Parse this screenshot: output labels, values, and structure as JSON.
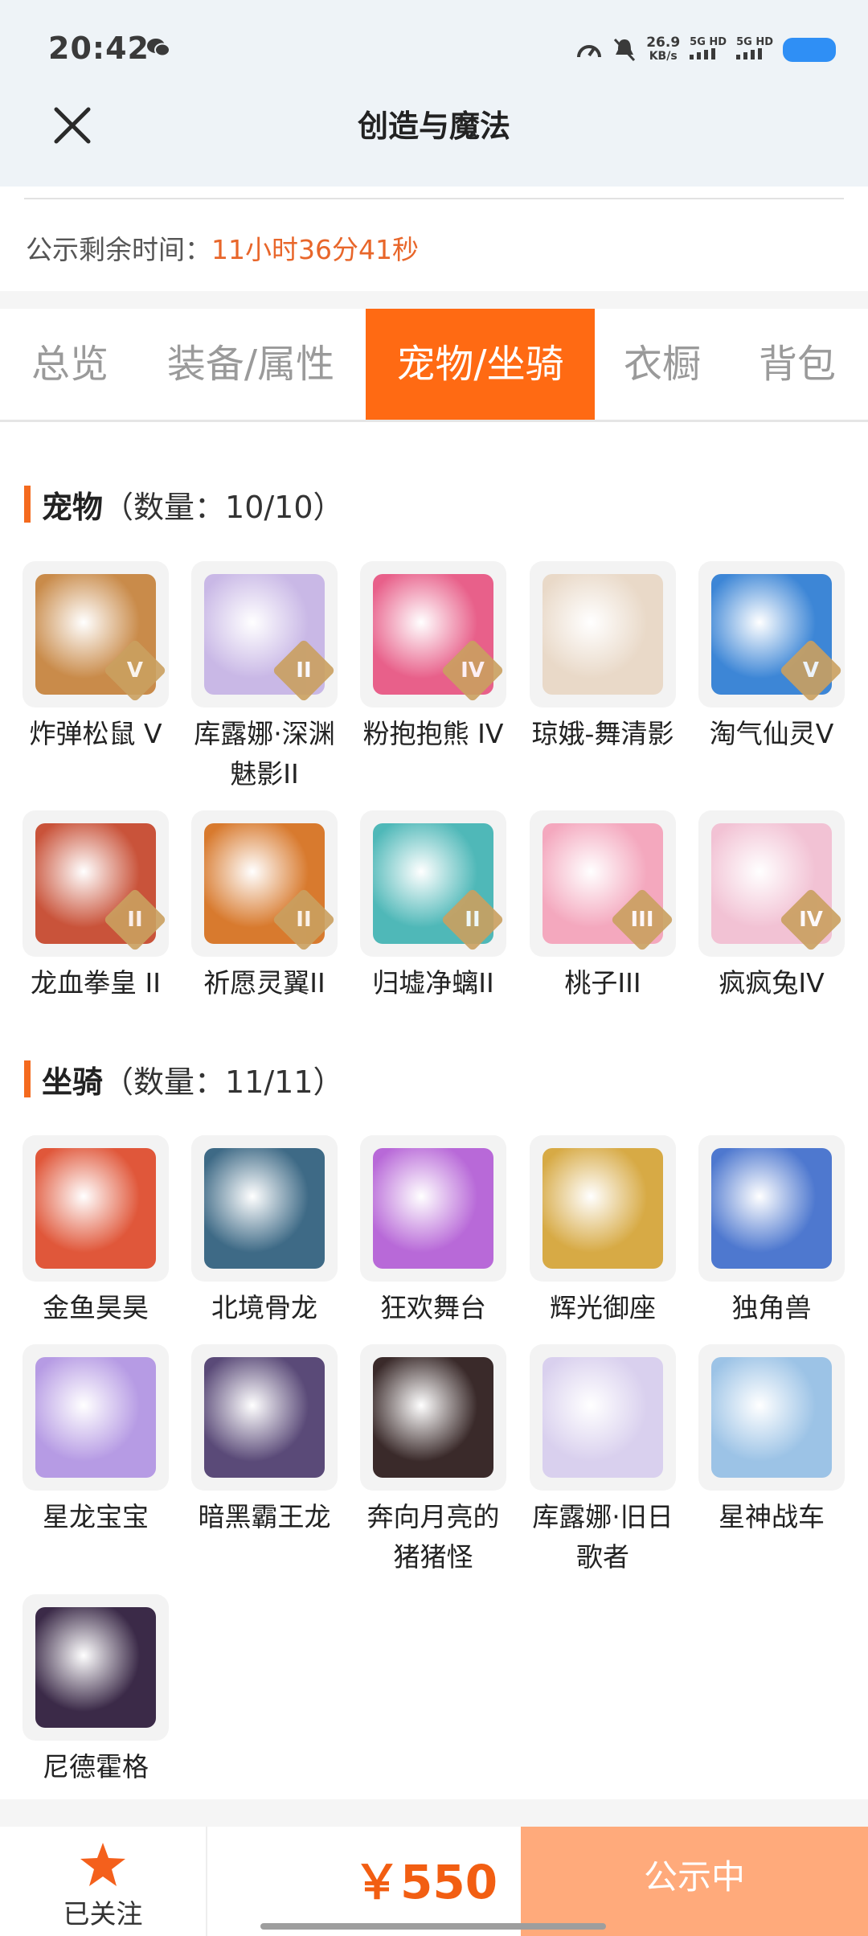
{
  "status_bar": {
    "time": "20:42",
    "net_speed": "26.9",
    "net_unit": "KB/s",
    "sim1": "5G HD",
    "sim2": "5G HD"
  },
  "header": {
    "title": "创造与魔法"
  },
  "notice": {
    "label": "公示剩余时间：",
    "value": "11小时36分41秒"
  },
  "tabs": [
    {
      "label": "总览"
    },
    {
      "label": "装备/属性"
    },
    {
      "label": "宠物/坐骑"
    },
    {
      "label": "衣橱"
    },
    {
      "label": "背包"
    }
  ],
  "active_tab": "宠物/坐骑",
  "pets": {
    "title": "宠物",
    "count": "（数量：10/10）",
    "items": [
      {
        "name": "炸弹松鼠 V",
        "tier": "V",
        "color": "#c98b4a"
      },
      {
        "name": "库露娜·深渊魅影II",
        "tier": "II",
        "color": "#c9b8e6"
      },
      {
        "name": "粉抱抱熊 IV",
        "tier": "IV",
        "color": "#e8608a"
      },
      {
        "name": "琼娥-舞清影",
        "tier": "",
        "color": "#e9d9c8"
      },
      {
        "name": "淘气仙灵V",
        "tier": "V",
        "color": "#3d86d6"
      },
      {
        "name": "龙血拳皇 II",
        "tier": "II",
        "color": "#c9533a"
      },
      {
        "name": "祈愿灵翼II",
        "tier": "II",
        "color": "#d87a2e"
      },
      {
        "name": "归墟净螭II",
        "tier": "II",
        "color": "#4fb8b8"
      },
      {
        "name": "桃子III",
        "tier": "III",
        "color": "#f4a8be"
      },
      {
        "name": "疯疯兔IV",
        "tier": "IV",
        "color": "#f2c2d4"
      }
    ]
  },
  "mounts": {
    "title": "坐骑",
    "count": "（数量：11/11）",
    "items": [
      {
        "name": "金鱼昊昊",
        "color": "#e0573a"
      },
      {
        "name": "北境骨龙",
        "color": "#3e6a86"
      },
      {
        "name": "狂欢舞台",
        "color": "#b869d8"
      },
      {
        "name": "辉光御座",
        "color": "#d7aa45"
      },
      {
        "name": "独角兽",
        "color": "#4e78cf"
      },
      {
        "name": "星龙宝宝",
        "color": "#b69be4"
      },
      {
        "name": "暗黑霸王龙",
        "color": "#5a4a78"
      },
      {
        "name": "奔向月亮的猪猪怪",
        "color": "#3a2a2a"
      },
      {
        "name": "库露娜·旧日歌者",
        "color": "#d9d0ee"
      },
      {
        "name": "星神战车",
        "color": "#9cc3e6"
      },
      {
        "name": "尼德霍格",
        "color": "#3b2a48"
      }
    ]
  },
  "bottom_bar": {
    "follow_label": "已关注",
    "price": "￥550",
    "status_button": "公示中"
  }
}
